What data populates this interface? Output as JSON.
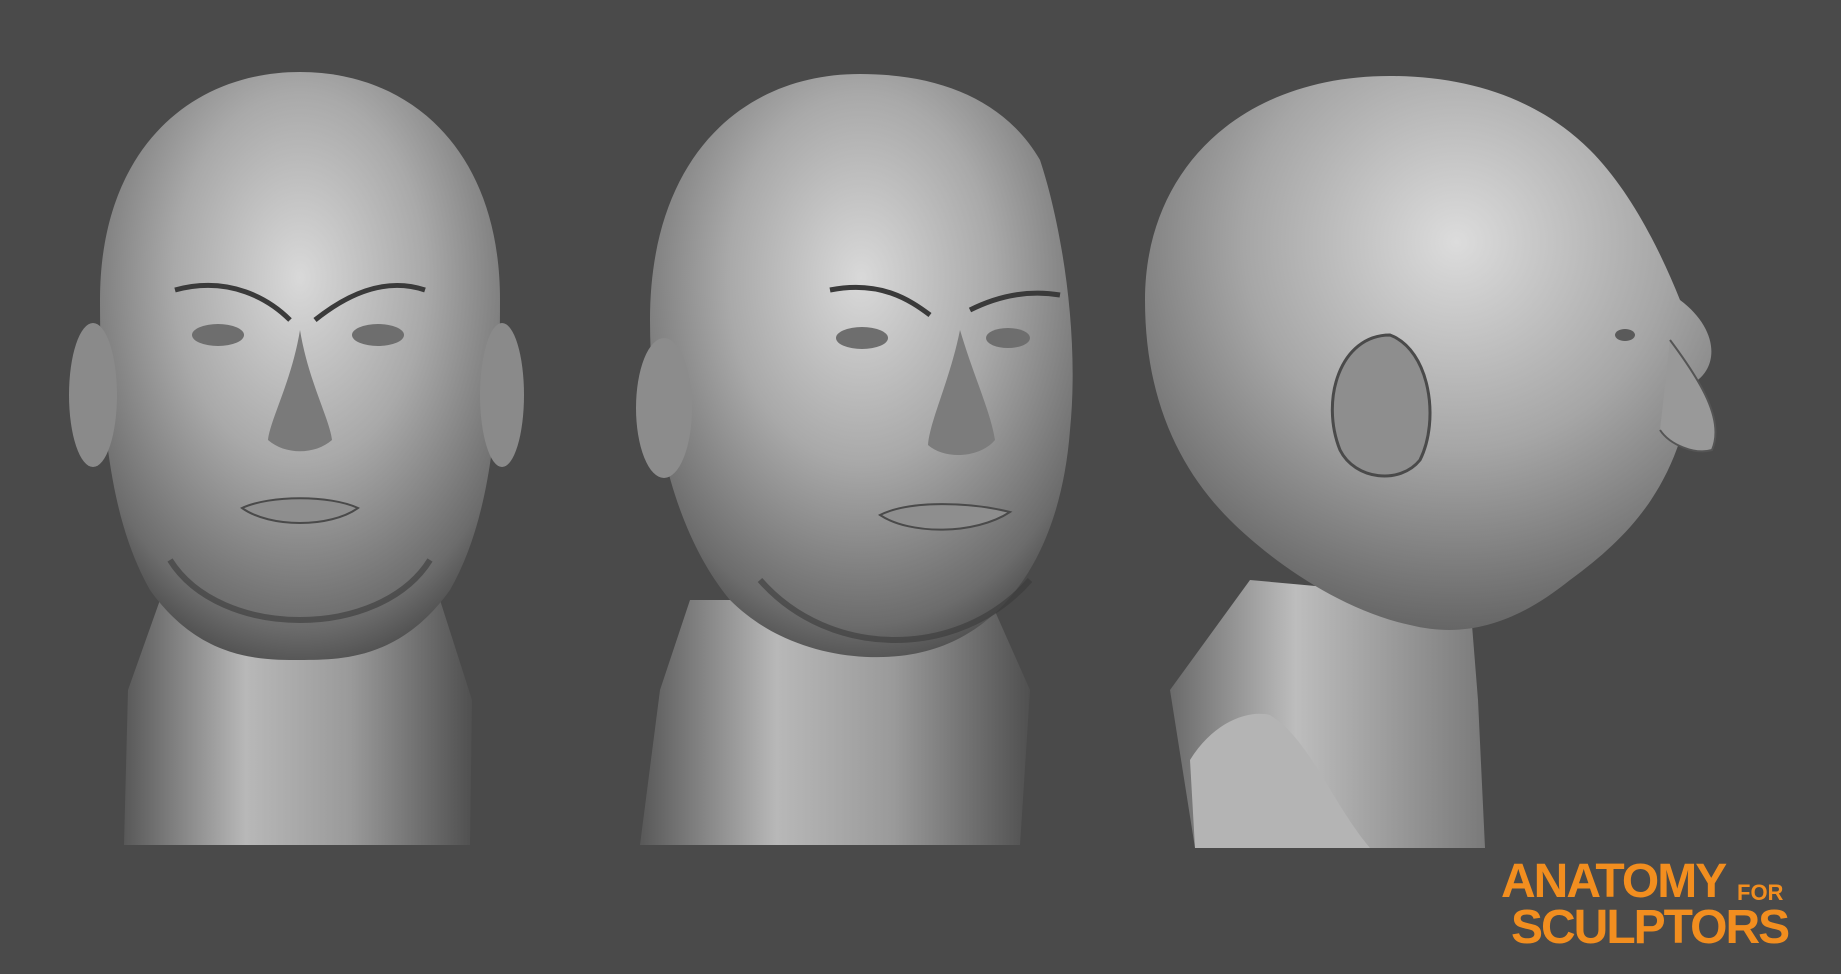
{
  "scene": {
    "subject": "sculpted-male-head",
    "views": [
      "front",
      "three-quarter",
      "profile"
    ],
    "colors": {
      "background": "#4a4a4a",
      "clay_light": "#d8d8d8",
      "clay_mid": "#8a8a8a",
      "clay_dark": "#3a3a3a"
    }
  },
  "logo": {
    "line1": "ANATOMY",
    "line1_small": "FOR",
    "line2": "SCULPTORS",
    "color": "#f28e1f"
  }
}
